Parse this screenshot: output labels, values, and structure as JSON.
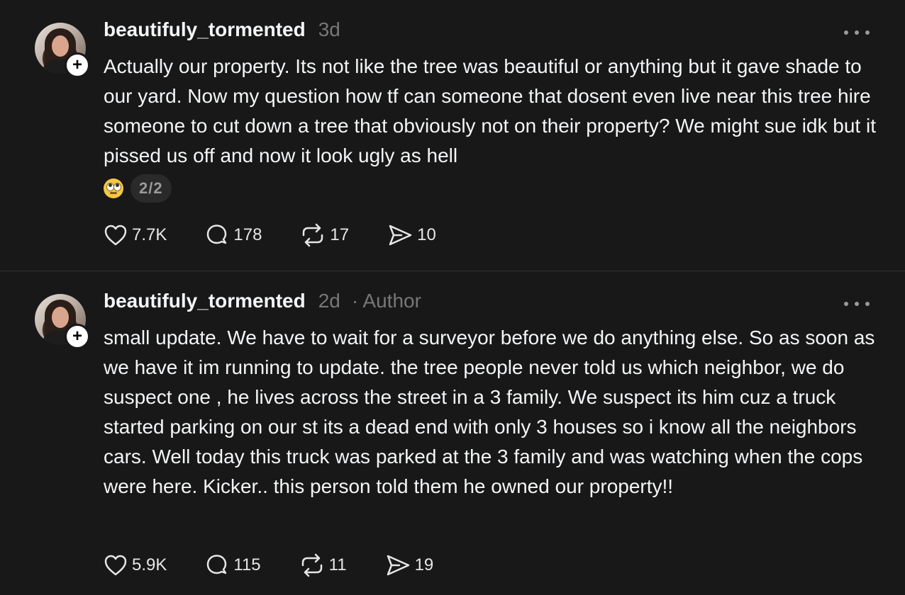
{
  "posts": [
    {
      "username": "beautifuly_tormented",
      "time": "3d",
      "author_tag": "",
      "text": "Actually our property. Its not like the tree was beautiful or anything but it gave shade to our yard. Now my question how tf can someone that dosent even live near this tree hire someone to cut down a tree that obviously not on their property? We might sue idk but it pissed us off and now it look ugly as hell",
      "emoji": "face-with-rolling-eyes-icon",
      "pager": "2/2",
      "likes": "7.7K",
      "replies": "178",
      "reposts": "17",
      "shares": "10"
    },
    {
      "username": "beautifuly_tormented",
      "time": "2d",
      "author_tag": "· Author",
      "text": "small update. We have to wait for a surveyor before we do anything else. So as soon as we have it im running to update. the tree people never told us which neighbor, we do suspect one , he lives across the street in a 3 family. We suspect its him cuz a truck started parking on our st its a dead end with only 3 houses so i know all the neighbors cars. Well today this truck was parked at the 3 family and was watching when the cops were here. Kicker.. this person told them he owned our property!!",
      "likes": "5.9K",
      "replies": "115",
      "reposts": "11",
      "shares": "19"
    }
  ],
  "colors": {
    "background": "#181818",
    "text": "#f3f5f7",
    "muted": "#777777",
    "divider": "#333333"
  }
}
